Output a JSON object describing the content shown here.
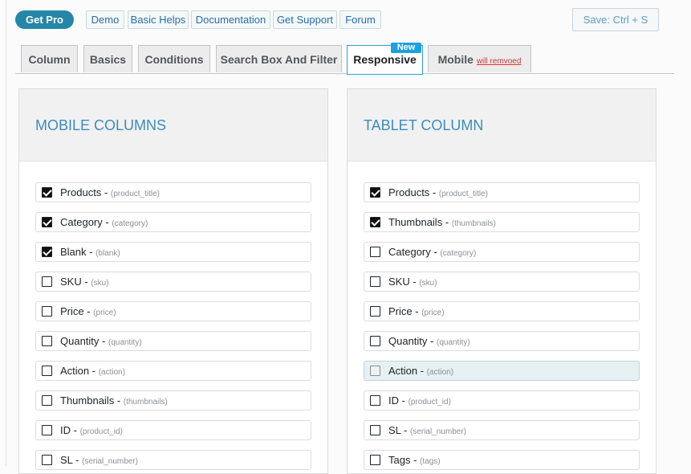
{
  "toolbar": {
    "get_pro": "Get Pro",
    "links": [
      "Demo",
      "Basic Helps",
      "Documentation",
      "Get Support",
      "Forum"
    ],
    "save": "Save: Ctrl + S"
  },
  "tabs": {
    "column": "Column",
    "basics": "Basics",
    "conditions": "Conditions",
    "search": "Search Box And Filter",
    "responsive": "Responsive",
    "new_badge": "New",
    "mobile": "Mobile",
    "mobile_note": "will remvoed"
  },
  "mobile_panel": {
    "title": "MOBILE COLUMNS",
    "items": [
      {
        "label": "Products",
        "key": "(product_title)",
        "checked": true
      },
      {
        "label": "Category",
        "key": "(category)",
        "checked": true
      },
      {
        "label": "Blank",
        "key": "(blank)",
        "checked": true
      },
      {
        "label": "SKU",
        "key": "(sku)",
        "checked": false
      },
      {
        "label": "Price",
        "key": "(price)",
        "checked": false
      },
      {
        "label": "Quantity",
        "key": "(quantity)",
        "checked": false
      },
      {
        "label": "Action",
        "key": "(action)",
        "checked": false
      },
      {
        "label": "Thumbnails",
        "key": "(thumbnails)",
        "checked": false
      },
      {
        "label": "ID",
        "key": "(product_id)",
        "checked": false
      },
      {
        "label": "SL",
        "key": "(serial_number)",
        "checked": false
      }
    ]
  },
  "tablet_panel": {
    "title": "TABLET COLUMN",
    "items": [
      {
        "label": "Products",
        "key": "(product_title)",
        "checked": true
      },
      {
        "label": "Thumbnails",
        "key": "(thumbnails)",
        "checked": true
      },
      {
        "label": "Category",
        "key": "(category)",
        "checked": false
      },
      {
        "label": "SKU",
        "key": "(sku)",
        "checked": false
      },
      {
        "label": "Price",
        "key": "(price)",
        "checked": false
      },
      {
        "label": "Quantity",
        "key": "(quantity)",
        "checked": false
      },
      {
        "label": "Action",
        "key": "(action)",
        "checked": false,
        "highlighted": true
      },
      {
        "label": "ID",
        "key": "(product_id)",
        "checked": false
      },
      {
        "label": "SL",
        "key": "(serial_number)",
        "checked": false
      },
      {
        "label": "Tags",
        "key": "(tags)",
        "checked": false
      }
    ]
  }
}
